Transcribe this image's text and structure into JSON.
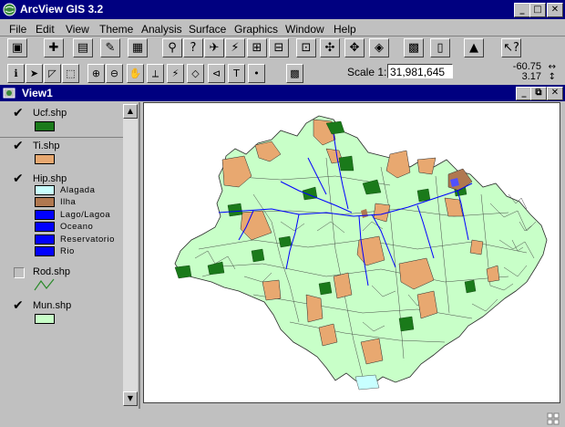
{
  "app": {
    "title": "ArcView GIS 3.2",
    "window_buttons": [
      "_",
      "□",
      "✕"
    ]
  },
  "menu": [
    "File",
    "Edit",
    "View",
    "Theme",
    "Analysis",
    "Surface",
    "Graphics",
    "Window",
    "Help"
  ],
  "toolbar": {
    "scale_label": "Scale 1:",
    "scale_value": "31,981,645",
    "coord_x": "-60.75",
    "coord_y": "3.17"
  },
  "view": {
    "title": "View1",
    "window_buttons": [
      "_",
      "⧉",
      "✕"
    ]
  },
  "themes": [
    {
      "name": "Ucf.shp",
      "checked": true,
      "classes": [
        {
          "label": "",
          "color": "#1a7a1a"
        }
      ]
    },
    {
      "name": "Ti.shp",
      "checked": true,
      "classes": [
        {
          "label": "",
          "color": "#e8a870"
        }
      ]
    },
    {
      "name": "Hip.shp",
      "checked": true,
      "classes": [
        {
          "label": "Alagada",
          "color": "#c8ffff"
        },
        {
          "label": "Ilha",
          "color": "#b07850"
        },
        {
          "label": "Lago/Lagoa",
          "color": "#0000ff"
        },
        {
          "label": "Oceano",
          "color": "#0000ff"
        },
        {
          "label": "Reservatorio",
          "color": "#0000ff"
        },
        {
          "label": "Rio",
          "color": "#0000ff"
        }
      ]
    },
    {
      "name": "Rod.shp",
      "checked": false,
      "classes": []
    },
    {
      "name": "Mun.shp",
      "checked": true,
      "classes": [
        {
          "label": "",
          "color": "#c8ffc8"
        }
      ]
    }
  ],
  "colors": {
    "title_bar": "#000080",
    "map_fill": "#c8ffc8",
    "indigenous": "#e8a870",
    "conservation": "#1a7a1a",
    "water": "#0000ff"
  }
}
